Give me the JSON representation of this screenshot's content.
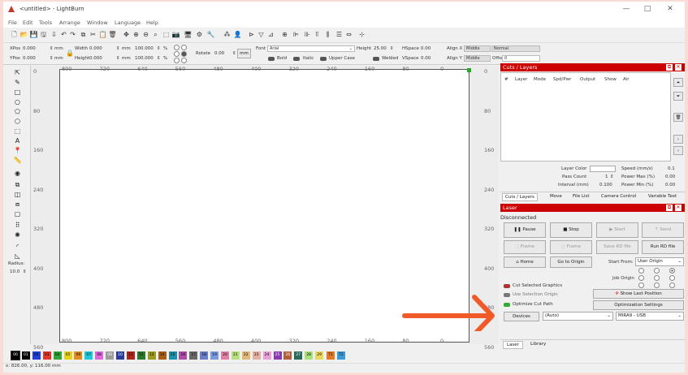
{
  "window": {
    "title": "<untitled> - LightBurn",
    "min": "—",
    "max": "□",
    "close": "✕"
  },
  "menu": [
    "File",
    "Edit",
    "Tools",
    "Arrange",
    "Window",
    "Language",
    "Help"
  ],
  "props": {
    "xpos_label": "XPos",
    "xpos": "0.000",
    "ypos_label": "YPos",
    "ypos": "0.000",
    "unit": "mm",
    "width_label": "Width",
    "width": "0.000",
    "height_label": "Height",
    "height": "0.000",
    "pct": "100.000",
    "pct_sym": "%",
    "rotate_label": "Rotate",
    "rotate": "0.00",
    "mm_btn": "mm",
    "font_label": "Font",
    "font": "Arial",
    "fheight_label": "Height",
    "fheight": "25.00",
    "hspace_label": "HSpace",
    "hspace": "0.00",
    "vspace_label": "VSpace",
    "vspace": "0.00",
    "alignx_label": "Align X",
    "alignx": "Middle",
    "aligny_label": "Align Y",
    "aligny": "Middle",
    "normal": "Normal",
    "offset_label": "Offset",
    "offset": "0",
    "bold": "Bold",
    "italic": "Italic",
    "upper": "Upper Case",
    "welded": "Welded"
  },
  "left": {
    "radius_label": "Radius:",
    "radius": "10.0"
  },
  "ruler": {
    "top": [
      "800",
      "720",
      "640",
      "560",
      "480",
      "400",
      "320",
      "240",
      "160",
      "80",
      "0"
    ],
    "bottom": [
      "800",
      "720",
      "640",
      "560",
      "480",
      "400",
      "320",
      "240",
      "160",
      "80",
      "0"
    ],
    "left": [
      "0",
      "80",
      "160",
      "240",
      "320",
      "400",
      "480",
      "560"
    ],
    "right": [
      "0",
      "80",
      "160",
      "240",
      "320",
      "400",
      "480",
      "560"
    ]
  },
  "palette": {
    "labels": [
      "00",
      "01",
      "02",
      "03",
      "04",
      "05",
      "06",
      "07",
      "08",
      "09",
      "10",
      "11",
      "12",
      "13",
      "14",
      "15",
      "16",
      "17",
      "18",
      "19",
      "20",
      "21",
      "22",
      "23",
      "24",
      "25",
      "26",
      "27",
      "28",
      "29",
      "T1",
      "T2"
    ],
    "colors": [
      "#000000",
      "#1f3fd6",
      "#e0362c",
      "#33a43a",
      "#e6d319",
      "#e08c1f",
      "#1ec8d6",
      "#e066e0",
      "#9c9c9c",
      "#2a3c9e",
      "#a8281f",
      "#2d7a2d",
      "#9c9a1f",
      "#a85e18",
      "#1f8fa8",
      "#a850a8",
      "#686868",
      "#6a7ec8",
      "#7a9ae0",
      "#e080a8",
      "#b8e07a",
      "#e0b87a",
      "#e6b0a0",
      "#e8a0d8",
      "#8a3ab0",
      "#b0603a",
      "#2a6a5a",
      "#a8e07a",
      "#e8d860",
      "#e07a2a",
      "#3a9ad6"
    ]
  },
  "status": "x: 826.00, y: 116.00 mm",
  "cuts": {
    "title": "Cuts / Layers",
    "cols": [
      "#",
      "Layer",
      "Mode",
      "Spd/Pwr",
      "Output",
      "Show",
      "Air"
    ],
    "layer_color": "Layer Color",
    "speed_label": "Speed (mm/s)",
    "speed": "0.1",
    "pass_label": "Pass Count",
    "pass": "1",
    "powermax_label": "Power Max (%)",
    "powermax": "0.00",
    "interval_label": "Interval (mm)",
    "interval": "0.100",
    "powermin_label": "Power Min (%)",
    "powermin": "0.00"
  },
  "dock_tabs": [
    "Cuts / Layers",
    "Move",
    "File List",
    "Camera Control",
    "Variable Text"
  ],
  "laser": {
    "title": "Laser",
    "status": "Disconnected",
    "pause": "Pause",
    "stop": "Stop",
    "start": "Start",
    "send": "Send",
    "frame1": "Frame",
    "frame2": "Frame",
    "save_rd": "Save RD file",
    "run_rd": "Run RD file",
    "home": "Home",
    "goto": "Go to Origin",
    "start_from_label": "Start From:",
    "start_from": "User Origin",
    "job_origin": "Job Origin",
    "cut_selected": "Cut Selected Graphics",
    "use_selection": "Use Selection Origin",
    "optimize": "Optimize Cut Path",
    "show_last": "Show Last Position",
    "opt_settings": "Optimization Settings",
    "devices": "Devices",
    "auto": "(Auto)",
    "port": "MIRA9 - USB"
  },
  "bottom_tabs": [
    "Laser",
    "Library"
  ],
  "colors": {
    "accent": "#cc0000",
    "arrow": "#f05a28"
  }
}
